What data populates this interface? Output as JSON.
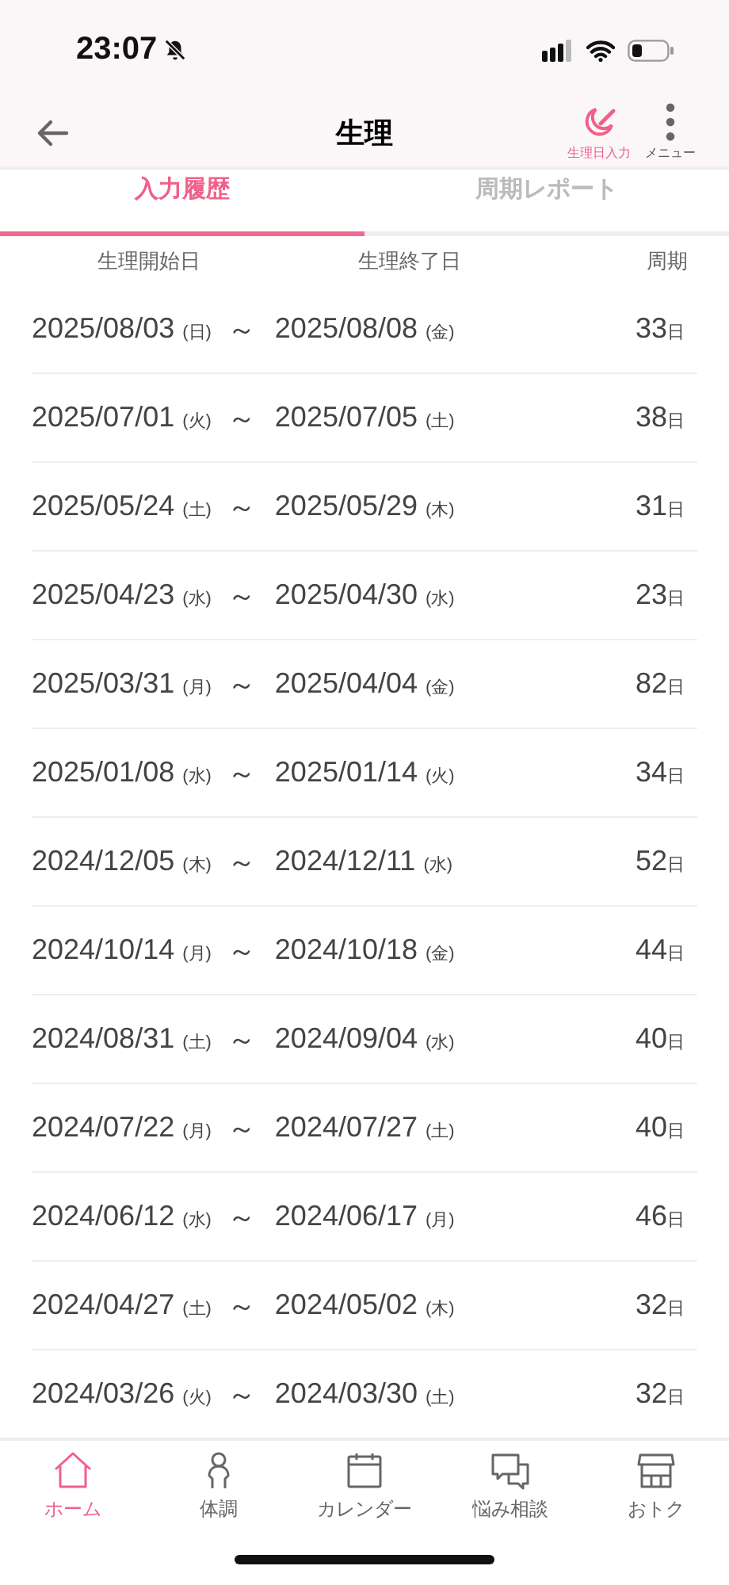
{
  "status_bar": {
    "time": "23:07",
    "silent": true
  },
  "nav": {
    "title": "生理",
    "actions": [
      {
        "kind": "entry",
        "label": "生理日入力"
      },
      {
        "kind": "menu",
        "label": "メニュー"
      }
    ]
  },
  "tabs": [
    {
      "label": "入力履歴",
      "selected": true
    },
    {
      "label": "周期レポート",
      "selected": false
    }
  ],
  "table": {
    "columns": [
      "生理開始日",
      "生理終了日",
      "周期"
    ],
    "rows": [
      {
        "start": "2025/08/03",
        "start_day": "(日)",
        "end": "2025/08/08",
        "end_day": "(金)",
        "cycle": "33",
        "unit": "日"
      },
      {
        "start": "2025/07/01",
        "start_day": "(火)",
        "end": "2025/07/05",
        "end_day": "(土)",
        "cycle": "38",
        "unit": "日"
      },
      {
        "start": "2025/05/24",
        "start_day": "(土)",
        "end": "2025/05/29",
        "end_day": "(木)",
        "cycle": "31",
        "unit": "日"
      },
      {
        "start": "2025/04/23",
        "start_day": "(水)",
        "end": "2025/04/30",
        "end_day": "(水)",
        "cycle": "23",
        "unit": "日"
      },
      {
        "start": "2025/03/31",
        "start_day": "(月)",
        "end": "2025/04/04",
        "end_day": "(金)",
        "cycle": "82",
        "unit": "日"
      },
      {
        "start": "2025/01/08",
        "start_day": "(水)",
        "end": "2025/01/14",
        "end_day": "(火)",
        "cycle": "34",
        "unit": "日"
      },
      {
        "start": "2024/12/05",
        "start_day": "(木)",
        "end": "2024/12/11",
        "end_day": "(水)",
        "cycle": "52",
        "unit": "日"
      },
      {
        "start": "2024/10/14",
        "start_day": "(月)",
        "end": "2024/10/18",
        "end_day": "(金)",
        "cycle": "44",
        "unit": "日"
      },
      {
        "start": "2024/08/31",
        "start_day": "(土)",
        "end": "2024/09/04",
        "end_day": "(水)",
        "cycle": "40",
        "unit": "日"
      },
      {
        "start": "2024/07/22",
        "start_day": "(月)",
        "end": "2024/07/27",
        "end_day": "(土)",
        "cycle": "40",
        "unit": "日"
      },
      {
        "start": "2024/06/12",
        "start_day": "(水)",
        "end": "2024/06/17",
        "end_day": "(月)",
        "cycle": "46",
        "unit": "日"
      },
      {
        "start": "2024/04/27",
        "start_day": "(土)",
        "end": "2024/05/02",
        "end_day": "(木)",
        "cycle": "32",
        "unit": "日"
      },
      {
        "start": "2024/03/26",
        "start_day": "(火)",
        "end": "2024/03/30",
        "end_day": "(土)",
        "cycle": "32",
        "unit": "日"
      }
    ],
    "separator": "～"
  },
  "bottom_nav": [
    {
      "kind": "home",
      "label": "ホーム",
      "selected": true
    },
    {
      "kind": "body",
      "label": "体調",
      "selected": false
    },
    {
      "kind": "calendar",
      "label": "カレンダー",
      "selected": false
    },
    {
      "kind": "chat",
      "label": "悩み相談",
      "selected": false
    },
    {
      "kind": "shop",
      "label": "おトク",
      "selected": false
    }
  ]
}
